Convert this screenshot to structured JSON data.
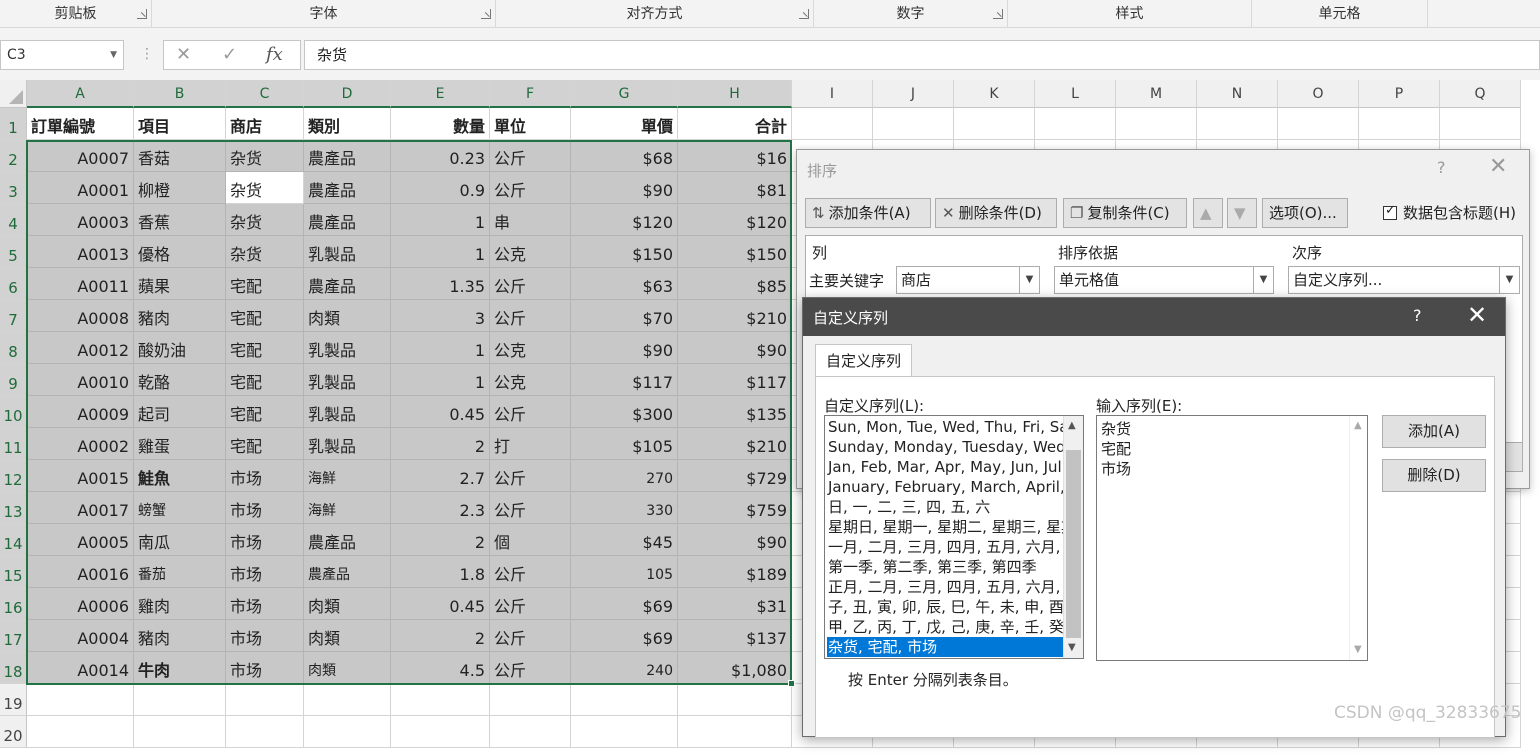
{
  "ribbon": {
    "groups": [
      "剪贴板",
      "字体",
      "对齐方式",
      "数字",
      "样式",
      "单元格"
    ]
  },
  "formula_bar": {
    "name_box": "C3",
    "cancel_icon": "✕",
    "enter_icon": "✓",
    "fx_label": "fx",
    "content": "杂货"
  },
  "sheet": {
    "columns": [
      "A",
      "B",
      "C",
      "D",
      "E",
      "F",
      "G",
      "H",
      "I",
      "J",
      "K",
      "L",
      "M",
      "N",
      "O",
      "P",
      "Q"
    ],
    "row_numbers": [
      "1",
      "2",
      "3",
      "4",
      "5",
      "6",
      "7",
      "8",
      "9",
      "10",
      "11",
      "12",
      "13",
      "14",
      "15",
      "16",
      "17",
      "18",
      "19",
      "20"
    ],
    "header": [
      "訂單編號",
      "項目",
      "商店",
      "類別",
      "數量",
      "單位",
      "單價",
      "合計"
    ],
    "rows": [
      [
        "A0007",
        "香菇",
        "杂货",
        "農產品",
        "0.23",
        "公斤",
        "$68",
        "$16"
      ],
      [
        "A0001",
        "柳橙",
        "杂货",
        "農產品",
        "0.9",
        "公斤",
        "$90",
        "$81"
      ],
      [
        "A0003",
        "香蕉",
        "杂货",
        "農產品",
        "1",
        "串",
        "$120",
        "$120"
      ],
      [
        "A0013",
        "優格",
        "杂货",
        "乳製品",
        "1",
        "公克",
        "$150",
        "$150"
      ],
      [
        "A0011",
        "蘋果",
        "宅配",
        "農產品",
        "1.35",
        "公斤",
        "$63",
        "$85"
      ],
      [
        "A0008",
        "豬肉",
        "宅配",
        "肉類",
        "3",
        "公斤",
        "$70",
        "$210"
      ],
      [
        "A0012",
        "酸奶油",
        "宅配",
        "乳製品",
        "1",
        "公克",
        "$90",
        "$90"
      ],
      [
        "A0010",
        "乾酪",
        "宅配",
        "乳製品",
        "1",
        "公克",
        "$117",
        "$117"
      ],
      [
        "A0009",
        "起司",
        "宅配",
        "乳製品",
        "0.45",
        "公斤",
        "$300",
        "$135"
      ],
      [
        "A0002",
        "雞蛋",
        "宅配",
        "乳製品",
        "2",
        "打",
        "$105",
        "$210"
      ],
      [
        "A0015",
        "鮭魚",
        "市场",
        "海鮮",
        "2.7",
        "公斤",
        "270",
        "$729"
      ],
      [
        "A0017",
        "螃蟹",
        "市场",
        "海鮮",
        "2.3",
        "公斤",
        "330",
        "$759"
      ],
      [
        "A0005",
        "南瓜",
        "市场",
        "農產品",
        "2",
        "個",
        "$45",
        "$90"
      ],
      [
        "A0016",
        "番茄",
        "市场",
        "農產品",
        "1.8",
        "公斤",
        "105",
        "$189"
      ],
      [
        "A0006",
        "雞肉",
        "市场",
        "肉類",
        "0.45",
        "公斤",
        "$69",
        "$31"
      ],
      [
        "A0004",
        "豬肉",
        "市场",
        "肉類",
        "2",
        "公斤",
        "$69",
        "$137"
      ],
      [
        "A0014",
        "牛肉",
        "市场",
        "肉類",
        "4.5",
        "公斤",
        "240",
        "$1,080"
      ]
    ]
  },
  "sort_dialog": {
    "title": "排序",
    "help": "?",
    "close": "✕",
    "add_level": "添加条件(A)",
    "delete_level": "删除条件(D)",
    "copy_level": "复制条件(C)",
    "options": "选项(O)...",
    "has_headers": "数据包含标题(H)",
    "col_header": "列",
    "sort_on_header": "排序依据",
    "order_header": "次序",
    "primary_key_label": "主要关键字",
    "column_value": "商店",
    "sort_on_value": "单元格值",
    "order_value": "自定义序列..."
  },
  "custom_dialog": {
    "title": "自定义序列",
    "help": "?",
    "close": "✕",
    "tab": "自定义序列",
    "lists_label": "自定义序列(L):",
    "entries_label": "输入序列(E):",
    "lists": [
      "Sun, Mon, Tue, Wed, Thu, Fri, Sat",
      "Sunday, Monday, Tuesday, Wednesday",
      "Jan, Feb, Mar, Apr, May, Jun, Jul, Aug",
      "January, February, March, April, May",
      "日, 一, 二, 三, 四, 五, 六",
      "星期日, 星期一, 星期二, 星期三, 星期四",
      "一月, 二月, 三月, 四月, 五月, 六月, 七月",
      "第一季, 第二季, 第三季, 第四季",
      "正月, 二月, 三月, 四月, 五月, 六月, 七月",
      "子, 丑, 寅, 卯, 辰, 巳, 午, 未, 申, 酉, 戌",
      "甲, 乙, 丙, 丁, 戊, 己, 庚, 辛, 壬, 癸",
      "杂货, 宅配, 市场"
    ],
    "selected_index": 11,
    "entries": [
      "杂货",
      "宅配",
      "市场"
    ],
    "add_button": "添加(A)",
    "delete_button": "删除(D)",
    "hint": "按 Enter 分隔列表条目。"
  },
  "watermark": "CSDN @qq_32833675"
}
